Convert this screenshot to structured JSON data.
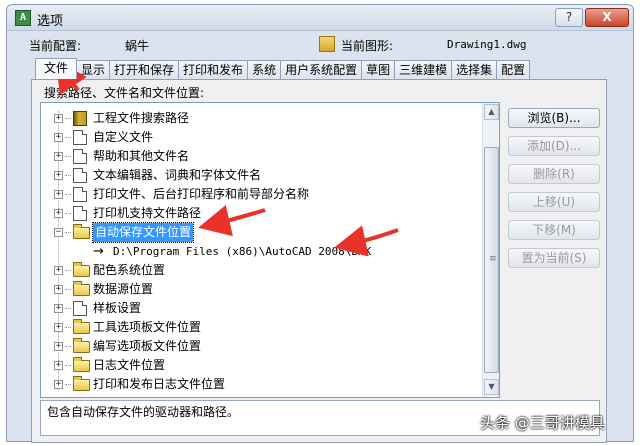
{
  "window": {
    "title": "选项",
    "help_glyph": "?",
    "close_glyph": "X",
    "app_icon": "autocad-icon"
  },
  "config": {
    "current_profile_label": "当前配置:",
    "current_profile_value": "蜗牛",
    "current_drawing_label": "当前图形:",
    "current_drawing_value": "Drawing1.dwg"
  },
  "tabs": [
    "文件",
    "显示",
    "打开和保存",
    "打印和发布",
    "系统",
    "用户系统配置",
    "草图",
    "三维建模",
    "选择集",
    "配置"
  ],
  "active_tab": "文件",
  "section_label": "搜索路径、文件名和文件位置:",
  "tree": [
    {
      "label": "工程文件搜索路径",
      "icon": "book"
    },
    {
      "label": "自定义文件",
      "icon": "document"
    },
    {
      "label": "帮助和其他文件名",
      "icon": "document"
    },
    {
      "label": "文本编辑器、词典和字体文件名",
      "icon": "document"
    },
    {
      "label": "打印文件、后台打印程序和前导部分名称",
      "icon": "document"
    },
    {
      "label": "打印机支持文件路径",
      "icon": "document"
    },
    {
      "label": "自动保存文件位置",
      "icon": "folder",
      "selected": true,
      "expanded": true
    },
    {
      "label": "D:\\Program Files (x86)\\AutoCAD 2008\\BAK",
      "icon": "arrow",
      "child": true
    },
    {
      "label": "配色系统位置",
      "icon": "folder"
    },
    {
      "label": "数据源位置",
      "icon": "folder"
    },
    {
      "label": "样板设置",
      "icon": "document"
    },
    {
      "label": "工具选项板文件位置",
      "icon": "folder"
    },
    {
      "label": "编写选项板文件位置",
      "icon": "folder"
    },
    {
      "label": "日志文件位置",
      "icon": "folder"
    },
    {
      "label": "打印和发布日志文件位置",
      "icon": "folder"
    }
  ],
  "buttons": {
    "browse": "浏览(B)...",
    "add": "添加(D)...",
    "delete": "删除(R)",
    "move_up": "上移(U)",
    "move_down": "下移(M)",
    "set_current": "置为当前(S)"
  },
  "status_text": "包含自动保存文件的驱动器和路径。",
  "watermark": "头条 @三哥讲模具",
  "colors": {
    "selection": "#3399ff",
    "annotation_arrow": "#e8322a"
  }
}
